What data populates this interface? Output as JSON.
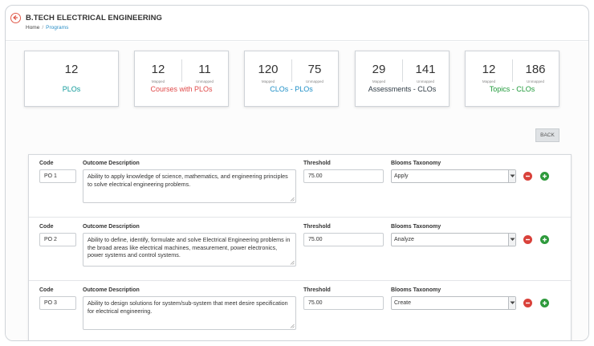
{
  "header": {
    "title": "B.TECH ELECTRICAL ENGINEERING",
    "breadcrumb": {
      "home": "Home",
      "separator": "/",
      "current": "Programs"
    }
  },
  "stats": [
    {
      "value": "12",
      "label": "PLOs",
      "color": "#0f9a9a"
    },
    {
      "mapped": "12",
      "unmapped": "11",
      "mapped_label": "Mapped",
      "unmapped_label": "Unmapped",
      "label": "Courses with PLOs",
      "color": "#e04a4a"
    },
    {
      "mapped": "120",
      "unmapped": "75",
      "mapped_label": "Mapped",
      "unmapped_label": "Unmapped",
      "label": "CLOs - PLOs",
      "color": "#1e8fc7"
    },
    {
      "mapped": "29",
      "unmapped": "141",
      "mapped_label": "Mapped",
      "unmapped_label": "Unmapped",
      "label": "Assessments - CLOs",
      "color": "#2f3b45"
    },
    {
      "mapped": "12",
      "unmapped": "186",
      "mapped_label": "Mapped",
      "unmapped_label": "Unmapped",
      "label": "Topics - CLOs",
      "color": "#1f9a3a"
    }
  ],
  "back_button": "BACK",
  "columns": {
    "code": "Code",
    "description": "Outcome Description",
    "threshold": "Threshold",
    "blooms": "Blooms Taxonomy"
  },
  "outcomes": [
    {
      "code": "PO 1",
      "description": "Ability to apply knowledge of science, mathematics, and engineering principles to solve electrical  engineering problems.",
      "threshold": "75.00",
      "blooms": "Apply"
    },
    {
      "code": "PO 2",
      "description": "Ability to define, identify, formulate and solve Electrical Engineering problems in the broad areas like electrical machines, measurement, power electronics, power systems and control systems.",
      "threshold": "75.00",
      "blooms": "Analyze"
    },
    {
      "code": "PO 3",
      "description": "Ability to design solutions for system/sub-system that meet desire specification for electrical engineering.",
      "threshold": "75.00",
      "blooms": "Create"
    }
  ]
}
